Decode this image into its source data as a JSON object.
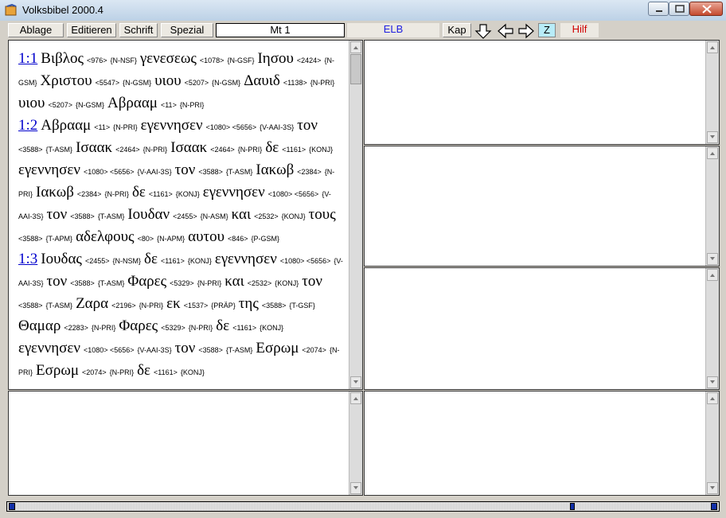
{
  "window": {
    "title": "Volksbibel 2000.4"
  },
  "toolbar": {
    "ablage": "Ablage",
    "editieren": "Editieren",
    "schrift": "Schrift",
    "spezial": "Spezial",
    "reference": "Mt 1",
    "translation": "ELB",
    "kap": "Kap",
    "z": "Z",
    "hilf": "Hilf"
  },
  "colors": {
    "translation_text": "#2020e0",
    "hilf_text": "#d00000",
    "z_bg": "#b8ecf8",
    "verse_link": "#0000cc"
  },
  "verses": [
    {
      "ref": "1:1",
      "tokens": [
        [
          "Βιβλος",
          "<976>",
          "{N-NSF}"
        ],
        [
          "γενεσεως",
          "<1078>",
          "{N-GSF}"
        ],
        [
          "Ιησου",
          "<2424>",
          "{N-GSM}"
        ],
        [
          "Χριστου",
          "<5547>",
          "{N-GSM}"
        ],
        [
          "υιου",
          "<5207>",
          "{N-GSM}"
        ],
        [
          "Δαυιδ",
          "<1138>",
          "{N-PRI}"
        ],
        [
          "υιου",
          "<5207>",
          "{N-GSM}"
        ],
        [
          "Αβρααμ",
          "<11>",
          "{N-PRI}"
        ]
      ]
    },
    {
      "ref": "1:2",
      "tokens": [
        [
          "Αβρααμ",
          "<11>",
          "{N-PRI}"
        ],
        [
          "εγεννησεν",
          "<1080> <5656>",
          "{V-AAI-3S}"
        ],
        [
          "τον",
          "<3588>",
          "{T-ASM}"
        ],
        [
          "Ισαακ",
          "<2464>",
          "{N-PRI}"
        ],
        [
          "Ισαακ",
          "<2464>",
          "{N-PRI}"
        ],
        [
          "δε",
          "<1161>",
          "{KONJ}"
        ],
        [
          "εγεννησεν",
          "<1080> <5656>",
          "{V-AAI-3S}"
        ],
        [
          "τον",
          "<3588>",
          "{T-ASM}"
        ],
        [
          "Ιακωβ",
          "<2384>",
          "{N-PRI}"
        ],
        [
          "Ιακωβ",
          "<2384>",
          "{N-PRI}"
        ],
        [
          "δε",
          "<1161>",
          "{KONJ}"
        ],
        [
          "εγεννησεν",
          "<1080> <5656>",
          "{V-AAI-3S}"
        ],
        [
          "τον",
          "<3588>",
          "{T-ASM}"
        ],
        [
          "Ιουδαν",
          "<2455>",
          "{N-ASM}"
        ],
        [
          "και",
          "<2532>",
          "{KONJ}"
        ],
        [
          "τους",
          "<3588>",
          "{T-APM}"
        ],
        [
          "αδελφους",
          "<80>",
          "{N-APM}"
        ],
        [
          "αυτου",
          "<846>",
          "{P-GSM}"
        ]
      ]
    },
    {
      "ref": "1:3",
      "tokens": [
        [
          "Ιουδας",
          "<2455>",
          "{N-NSM}"
        ],
        [
          "δε",
          "<1161>",
          "{KONJ}"
        ],
        [
          "εγεννησεν",
          "<1080> <5656>",
          "{V-AAI-3S}"
        ],
        [
          "τον",
          "<3588>",
          "{T-ASM}"
        ],
        [
          "Φαρες",
          "<5329>",
          "{N-PRI}"
        ],
        [
          "και",
          "<2532>",
          "{KONJ}"
        ],
        [
          "τον",
          "<3588>",
          "{T-ASM}"
        ],
        [
          "Ζαρα",
          "<2196>",
          "{N-PRI}"
        ],
        [
          "εκ",
          "<1537>",
          "{PRÄP}"
        ],
        [
          "της",
          "<3588>",
          "{T-GSF}"
        ],
        [
          "Θαμαρ",
          "<2283>",
          "{N-PRI}"
        ],
        [
          "Φαρες",
          "<5329>",
          "{N-PRI}"
        ],
        [
          "δε",
          "<1161>",
          "{KONJ}"
        ],
        [
          "εγεννησεν",
          "<1080> <5656>",
          "{V-AAI-3S}"
        ],
        [
          "τον",
          "<3588>",
          "{T-ASM}"
        ],
        [
          "Εσρωμ",
          "<2074>",
          "{N-PRI}"
        ],
        [
          "Εσρωμ",
          "<2074>",
          "{N-PRI}"
        ],
        [
          "δε",
          "<1161>",
          "{KONJ}"
        ]
      ]
    }
  ]
}
